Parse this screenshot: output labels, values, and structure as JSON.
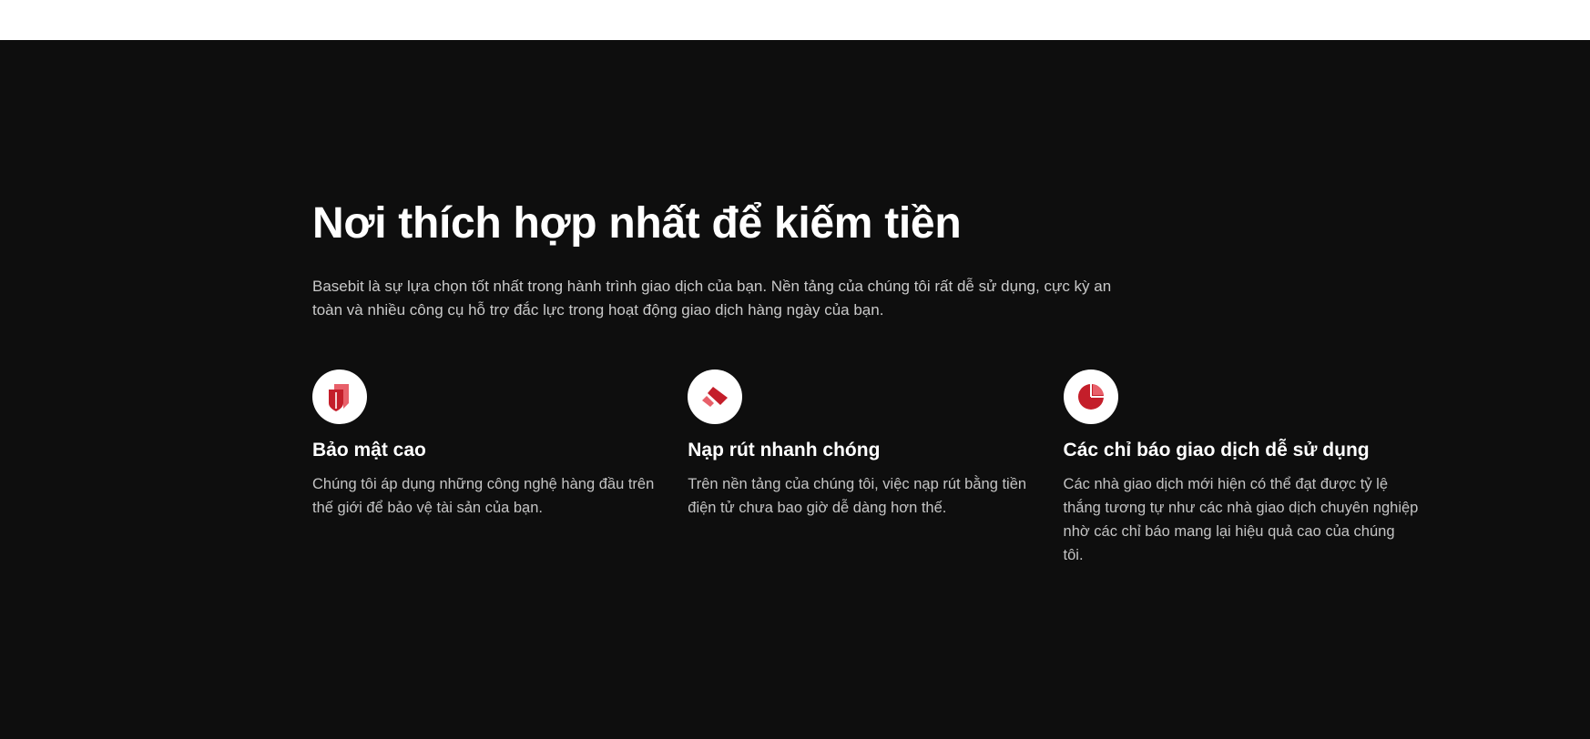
{
  "section": {
    "title": "Nơi thích hợp nhất để kiếm tiền",
    "intro": "Basebit là sự lựa chọn tốt nhất trong hành trình giao dịch của bạn. Nền tảng của chúng tôi rất dễ sử dụng, cực kỳ an toàn và nhiều công cụ hỗ trợ đắc lực trong hoạt động giao dịch hàng ngày của bạn."
  },
  "features": [
    {
      "icon": "shield-icon",
      "title": "Bảo mật cao",
      "description": "Chúng tôi áp dụng những công nghệ hàng đầu trên thế giới để bảo vệ tài sản của bạn."
    },
    {
      "icon": "transfer-icon",
      "title": "Nạp rút nhanh chóng",
      "description": "Trên nền tảng của chúng tôi, việc nạp rút bằng tiền điện tử chưa bao giờ dễ dàng hơn thế."
    },
    {
      "icon": "pie-chart-icon",
      "title": "Các chỉ báo giao dịch dễ sử dụng",
      "description": "Các nhà giao dịch mới hiện có thể đạt được tỷ lệ thắng tương tự như các nhà giao dịch chuyên nghiệp nhờ các chỉ báo mang lại hiệu quả cao của chúng tôi."
    }
  ],
  "colors": {
    "background": "#0e0e0e",
    "accent_dark": "#c41e2a",
    "accent_light": "#e8606a"
  }
}
